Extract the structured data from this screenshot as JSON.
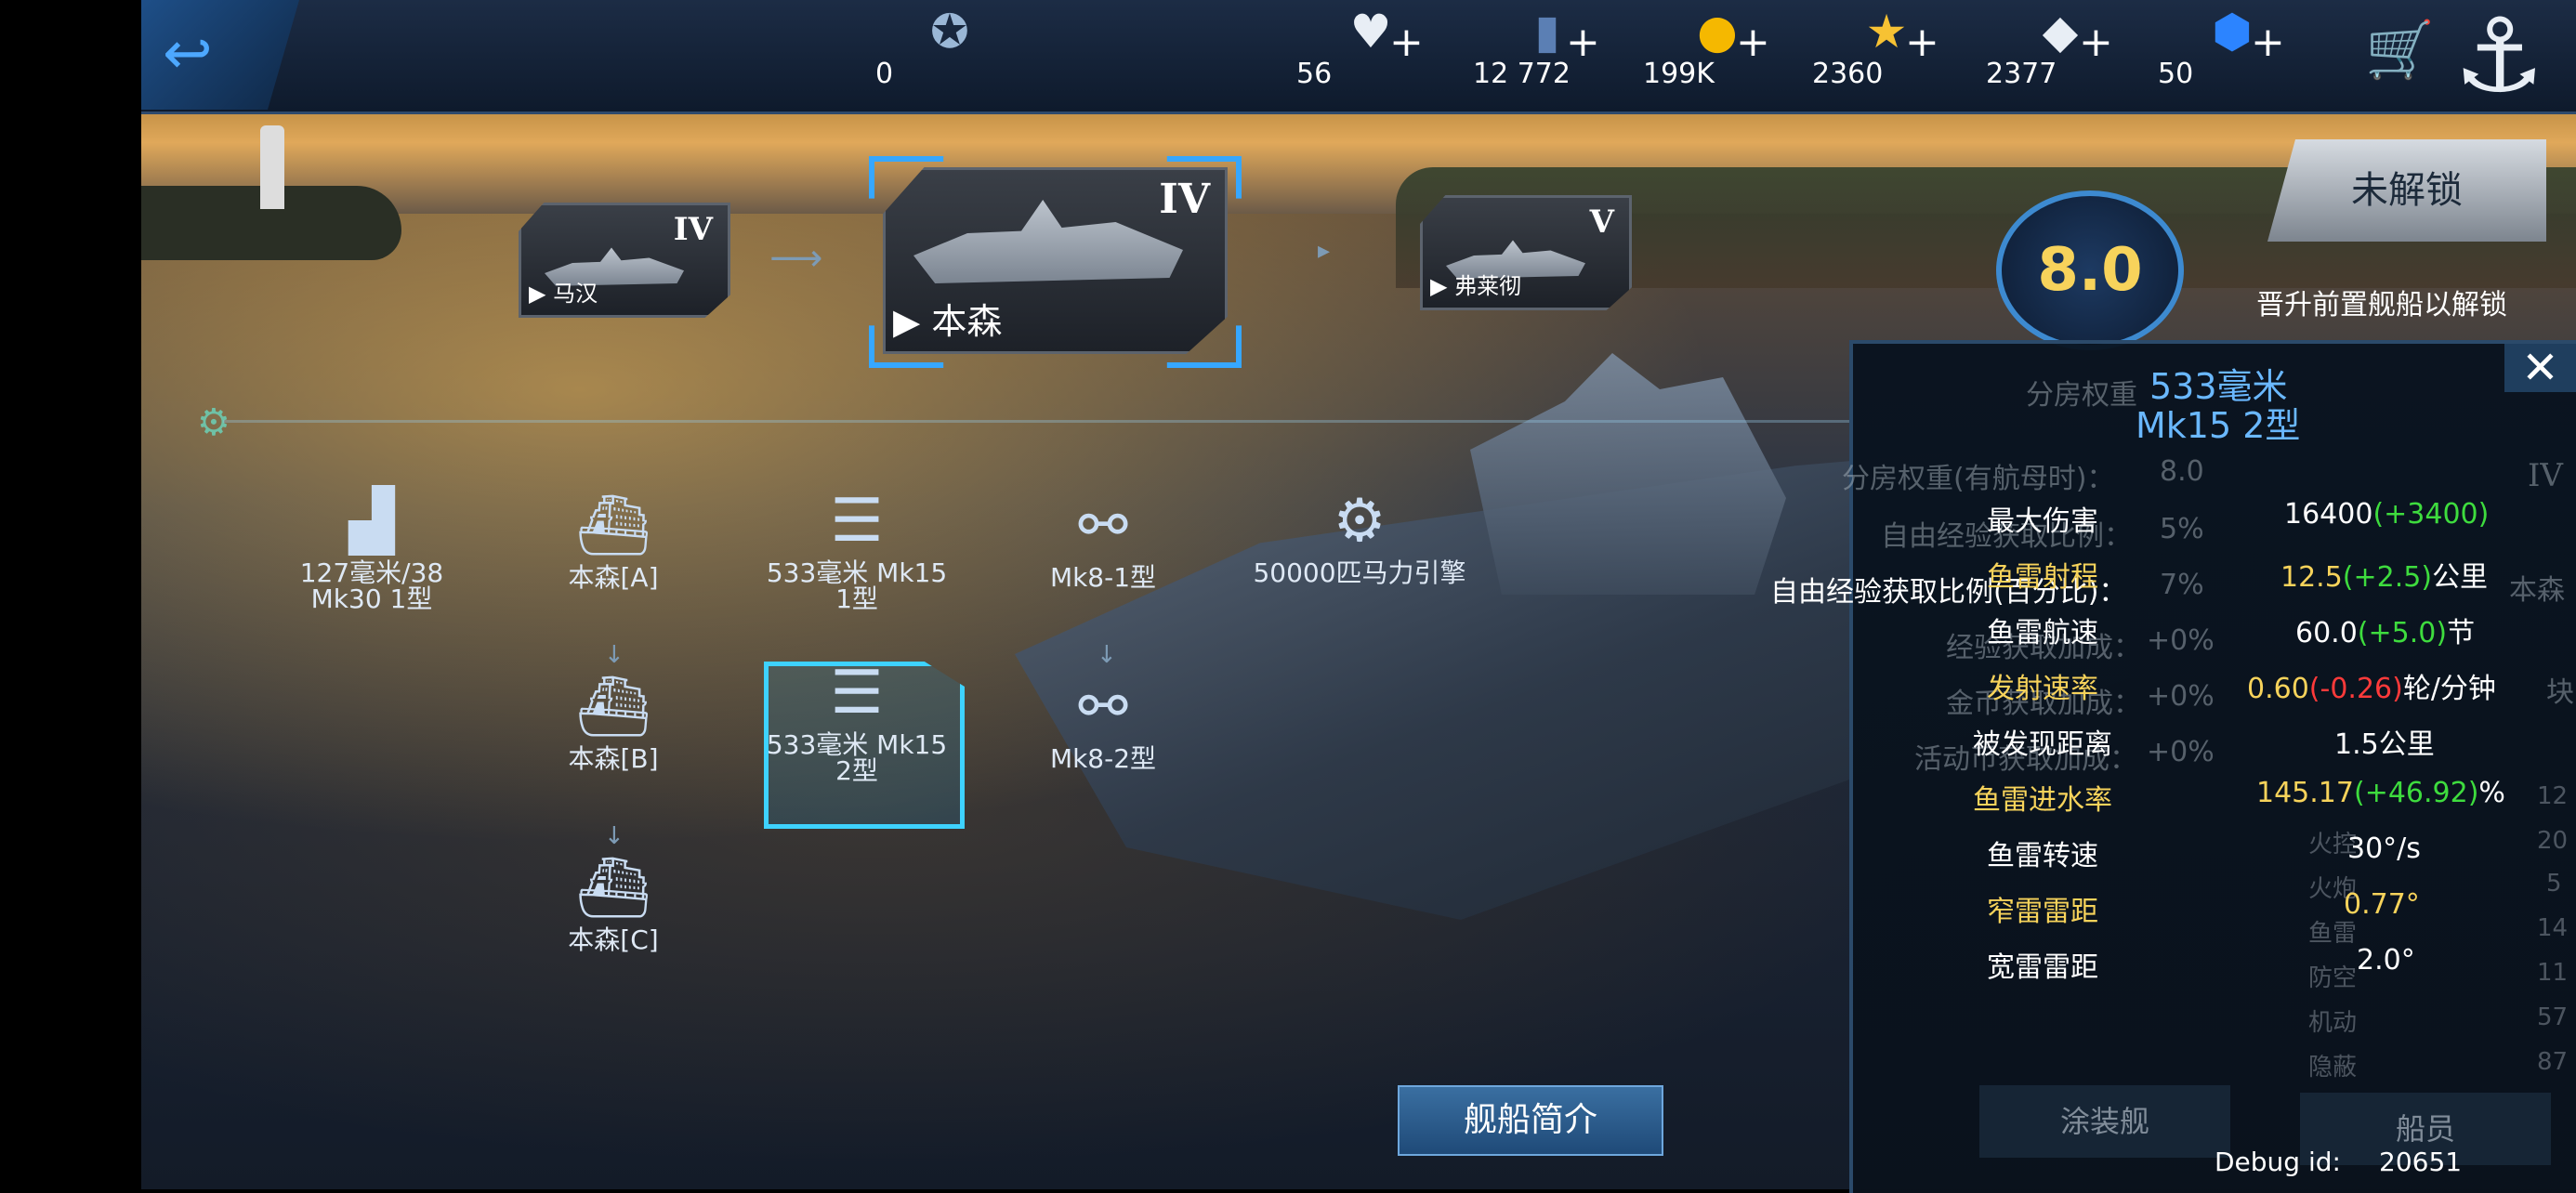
{
  "topbar": {
    "resources": [
      {
        "icon": "star-badge-icon",
        "value": "0"
      },
      {
        "icon": "heart-icon",
        "value": "56"
      },
      {
        "icon": "card-icon",
        "value": "12 772"
      },
      {
        "icon": "gold-coin-icon",
        "value": "199K"
      },
      {
        "icon": "star-icon",
        "value": "2360"
      },
      {
        "icon": "diamond-icon",
        "value": "2377"
      },
      {
        "icon": "blue-gem-icon",
        "value": "50"
      }
    ]
  },
  "tree": {
    "prev_ship": {
      "tier": "IV",
      "name": "马汉"
    },
    "current_ship": {
      "tier": "IV",
      "name": "本森"
    },
    "next_ship": {
      "tier": "V",
      "name": "弗莱彻"
    }
  },
  "modules": {
    "gun": "127毫米/38 Mk30 1型",
    "hull_a": "本森[A]",
    "torp1": "533毫米 Mk15 1型",
    "radar1": "Mk8-1型",
    "engine": "50000匹马力引擎",
    "hull_b": "本森[B]",
    "torp2": "533毫米 Mk15 2型",
    "radar2": "Mk8-2型",
    "hull_c": "本森[C]"
  },
  "unlock": {
    "button": "未解锁",
    "tip": "晋升前置舰船以解锁",
    "score": "8.0"
  },
  "panel": {
    "title1": "533毫米",
    "title2": "Mk15 2型",
    "ghost_lines": [
      "分房权重",
      "分房权重(有航母时)：",
      "自由经验获取比例：",
      "自由经验获取比例(百分比)：",
      "经验获取加成：",
      "金币获取加成：",
      "活动币获取加成："
    ],
    "ghost_values": [
      "8.0",
      "5%",
      "7%",
      "+0%",
      "+0%",
      "+0%"
    ],
    "stats": [
      {
        "label": "最大伤害",
        "base": "16400",
        "delta": "(+3400)",
        "unit": ""
      },
      {
        "label": "鱼雷射程",
        "base": "12.5",
        "delta": "(+2.5)",
        "unit": "公里"
      },
      {
        "label": "鱼雷航速",
        "base": "60.0",
        "delta": "(+5.0)",
        "unit": "节"
      },
      {
        "label": "发射速率",
        "base": "0.60",
        "delta": "(-0.26)",
        "unit": "轮/分钟"
      },
      {
        "label": "被发现距离",
        "base": "1.5公里",
        "delta": "",
        "unit": ""
      },
      {
        "label": "鱼雷进水率",
        "base": "145.17",
        "delta": "(+46.92)",
        "unit": "%"
      },
      {
        "label": "鱼雷转速",
        "base": "30°/s",
        "delta": "",
        "unit": ""
      },
      {
        "label": "窄雷雷距",
        "base": "0.77°",
        "delta": "",
        "unit": ""
      },
      {
        "label": "宽雷雷距",
        "base": "2.0°",
        "delta": "",
        "unit": ""
      }
    ],
    "side_stats": [
      {
        "label": "火控",
        "value": "12"
      },
      {
        "label": "火炮",
        "value": "20"
      },
      {
        "label": "鱼雷",
        "value": "5"
      },
      {
        "label": "防空",
        "value": "14"
      },
      {
        "label": "机动",
        "value": "11"
      },
      {
        "label": "隐蔽",
        "value": "57"
      },
      {
        "label": "",
        "value": "87"
      }
    ],
    "bg_tier": "IV",
    "bg_name": "本森",
    "bg_char": "块",
    "paint_btn": "涂装舰",
    "crew_btn": "船员"
  },
  "footer": {
    "intro_btn": "舰船简介",
    "debug_label": "Debug id:",
    "debug_value": "20651"
  }
}
